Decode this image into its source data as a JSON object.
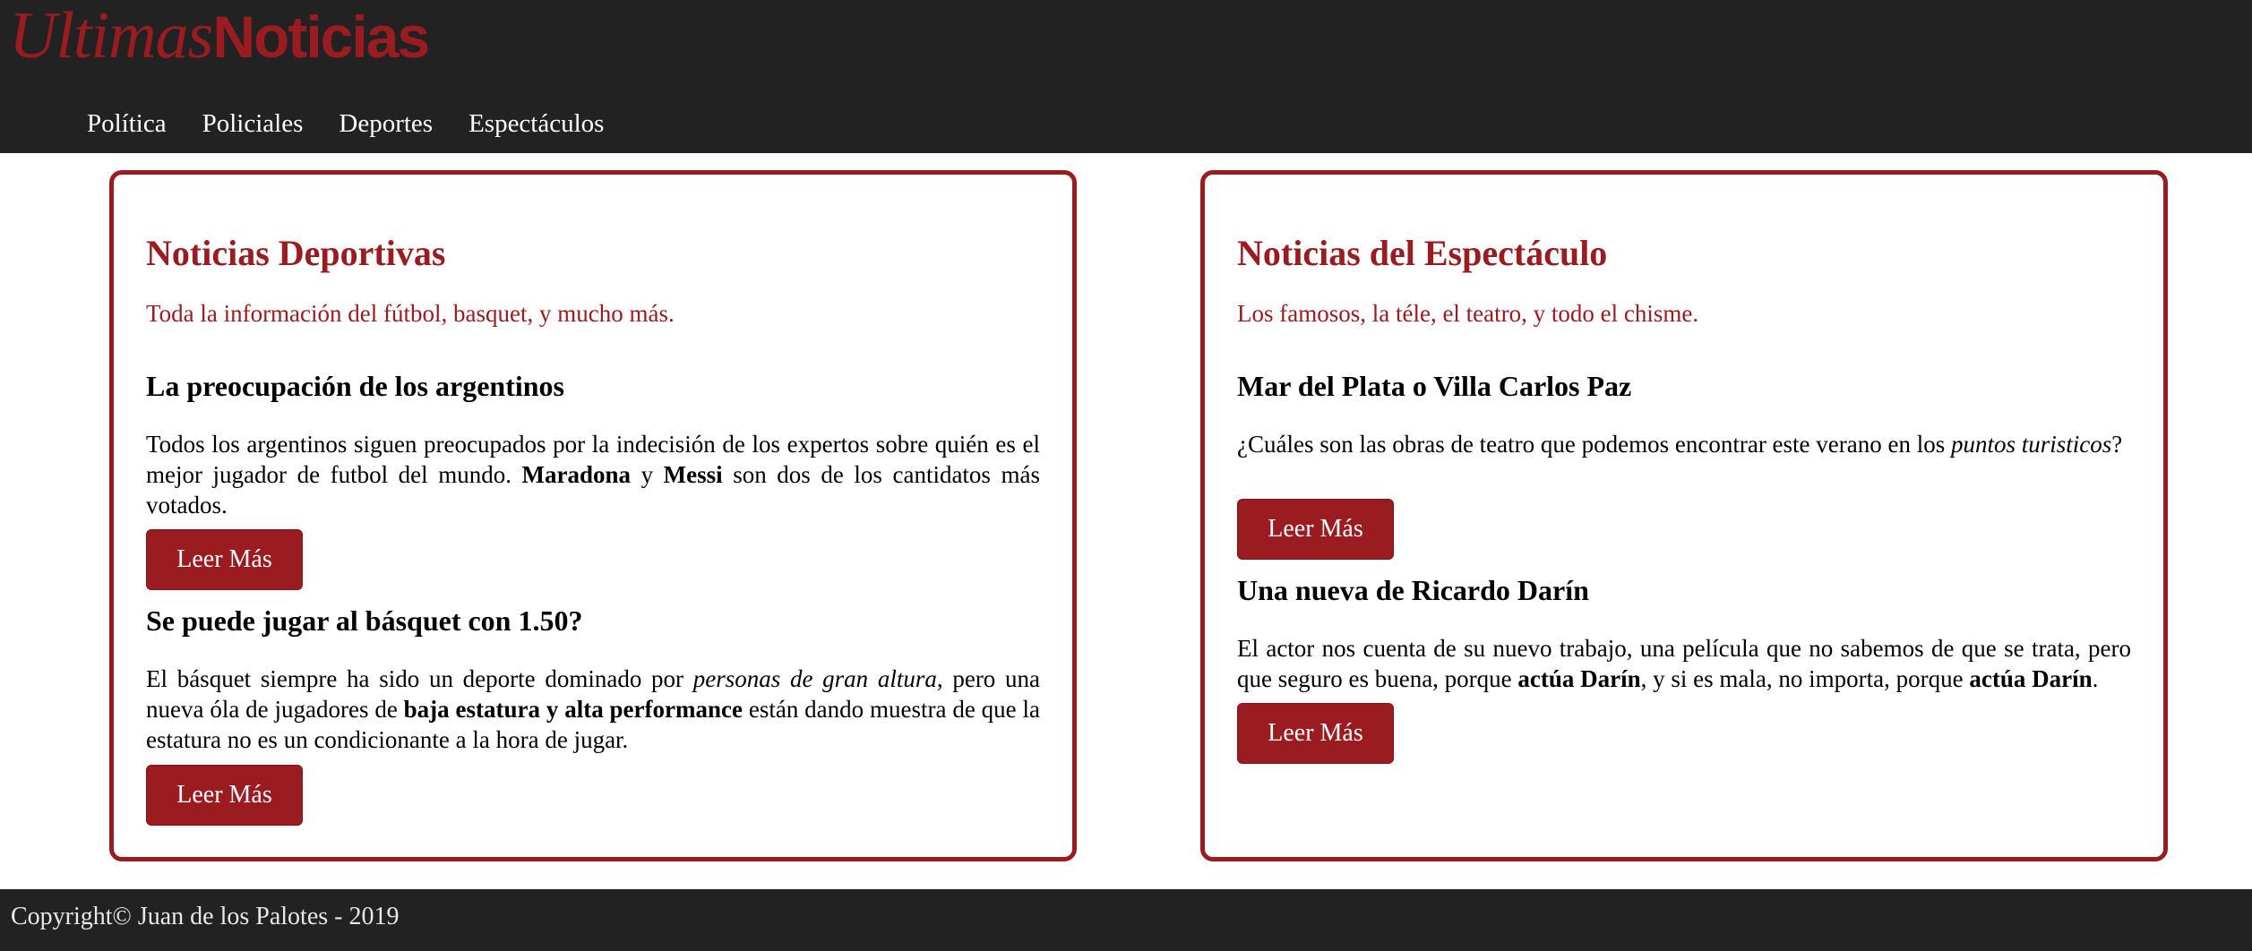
{
  "header": {
    "logo_italic": "Ultimas",
    "logo_bold": "Noticias",
    "nav": [
      "Política",
      "Policiales",
      "Deportes",
      "Espectáculos"
    ]
  },
  "sports": {
    "title": "Noticias Deportivas",
    "subtitle": "Toda la información del fútbol, basquet, y mucho más.",
    "articles": [
      {
        "title": "La preocupación de los argentinos",
        "body": [
          {
            "t": "Todos los argentinos siguen preocupados por la indecisión de los expertos sobre quién es el mejor jugador de futbol del mundo. "
          },
          {
            "t": "Maradona",
            "b": true
          },
          {
            "t": " y "
          },
          {
            "t": "Messi",
            "b": true
          },
          {
            "t": " son dos de los cantidatos más votados."
          }
        ],
        "button": "Leer Más"
      },
      {
        "title": "Se puede jugar al básquet con 1.50?",
        "body": [
          {
            "t": "El básquet siempre ha sido un deporte dominado por "
          },
          {
            "t": "personas de gran altura",
            "i": true
          },
          {
            "t": ", pero una nueva óla de jugadores de "
          },
          {
            "t": "baja estatura y alta performance",
            "b": true
          },
          {
            "t": " están dando muestra de que la estatura no es un condicionante a la hora de jugar."
          }
        ],
        "button": "Leer Más"
      }
    ]
  },
  "shows": {
    "title": "Noticias del Espectáculo",
    "subtitle": "Los famosos, la téle, el teatro, y todo el chisme.",
    "articles": [
      {
        "title": "Mar del Plata o Villa Carlos Paz",
        "body": [
          {
            "t": "¿Cuáles son las obras de teatro que podemos encontrar este verano en los "
          },
          {
            "t": "puntos turisticos",
            "i": true
          },
          {
            "t": "?"
          }
        ],
        "button": "Leer Más"
      },
      {
        "title": "Una nueva de Ricardo Darín",
        "body": [
          {
            "t": "El actor nos cuenta de su nuevo trabajo, una película que no sabemos de que se trata, pero que seguro es buena, porque "
          },
          {
            "t": "actúa Darín",
            "b": true
          },
          {
            "t": ", y si es mala, no importa, porque "
          },
          {
            "t": "actúa Darín",
            "b": true
          },
          {
            "t": "."
          }
        ],
        "button": "Leer Más"
      }
    ]
  },
  "footer": {
    "text": "Copyright© Juan de los Palotes - 2019"
  },
  "colors": {
    "accent": "#9b1c20",
    "dark": "#222222",
    "white": "#ffffff"
  }
}
